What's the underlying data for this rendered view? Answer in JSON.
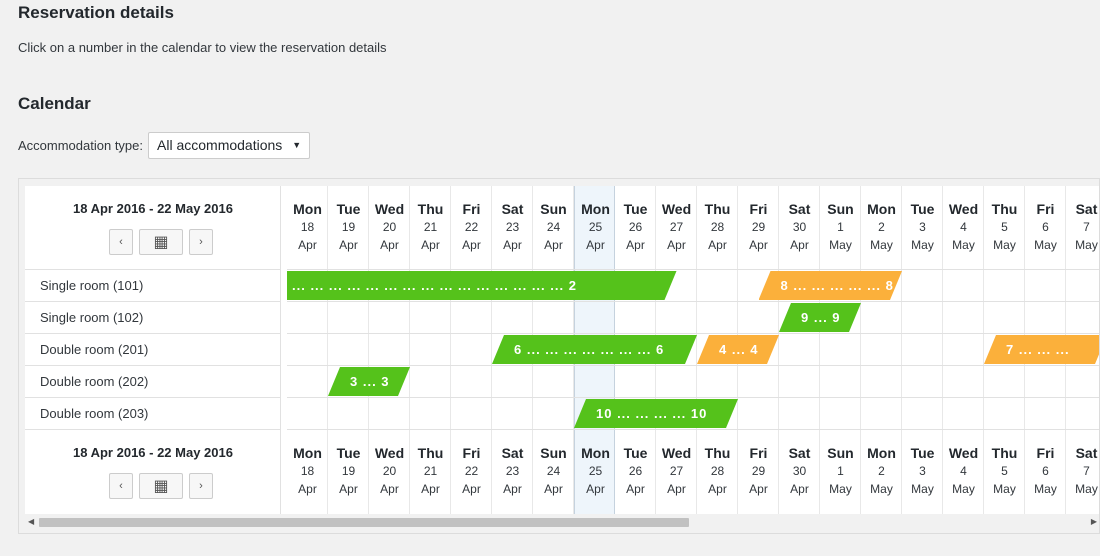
{
  "page": {
    "reservation_title": "Reservation details",
    "reservation_desc": "Click on a number in the calendar to view the reservation details",
    "calendar_title": "Calendar",
    "accommodation_label": "Accommodation type:",
    "accommodation_value": "All accommodations"
  },
  "calendar": {
    "range": "18 Apr 2016 - 22 May 2016",
    "today_index": 7,
    "days": [
      {
        "dn": "Mon",
        "dd": "18",
        "mm": "Apr"
      },
      {
        "dn": "Tue",
        "dd": "19",
        "mm": "Apr"
      },
      {
        "dn": "Wed",
        "dd": "20",
        "mm": "Apr"
      },
      {
        "dn": "Thu",
        "dd": "21",
        "mm": "Apr"
      },
      {
        "dn": "Fri",
        "dd": "22",
        "mm": "Apr"
      },
      {
        "dn": "Sat",
        "dd": "23",
        "mm": "Apr"
      },
      {
        "dn": "Sun",
        "dd": "24",
        "mm": "Apr"
      },
      {
        "dn": "Mon",
        "dd": "25",
        "mm": "Apr"
      },
      {
        "dn": "Tue",
        "dd": "26",
        "mm": "Apr"
      },
      {
        "dn": "Wed",
        "dd": "27",
        "mm": "Apr"
      },
      {
        "dn": "Thu",
        "dd": "28",
        "mm": "Apr"
      },
      {
        "dn": "Fri",
        "dd": "29",
        "mm": "Apr"
      },
      {
        "dn": "Sat",
        "dd": "30",
        "mm": "Apr"
      },
      {
        "dn": "Sun",
        "dd": "1",
        "mm": "May"
      },
      {
        "dn": "Mon",
        "dd": "2",
        "mm": "May"
      },
      {
        "dn": "Tue",
        "dd": "3",
        "mm": "May"
      },
      {
        "dn": "Wed",
        "dd": "4",
        "mm": "May"
      },
      {
        "dn": "Thu",
        "dd": "5",
        "mm": "May"
      },
      {
        "dn": "Fri",
        "dd": "6",
        "mm": "May"
      },
      {
        "dn": "Sat",
        "dd": "7",
        "mm": "May"
      }
    ],
    "rooms": [
      "Single room (101)",
      "Single room (102)",
      "Double room (201)",
      "Double room (202)",
      "Double room (203)"
    ],
    "reservations": [
      {
        "room": 0,
        "start": 0,
        "end": 9.5,
        "color": "green",
        "label": "... ... ... ... ... ... ... ... ... ... ... ... ... ... ... 2"
      },
      {
        "room": 0,
        "start": 11.5,
        "end": 15,
        "color": "orange",
        "label": "8 ... ... ... ... ... 8"
      },
      {
        "room": 1,
        "start": 12,
        "end": 14,
        "color": "green",
        "label": "9 ... 9"
      },
      {
        "room": 2,
        "start": 5,
        "end": 10,
        "color": "green",
        "label": "6 ... ... ... ... ... ... ... 6"
      },
      {
        "room": 2,
        "start": 10,
        "end": 12,
        "color": "orange",
        "label": "4 ... 4"
      },
      {
        "room": 2,
        "start": 17,
        "end": 20,
        "color": "orange",
        "label": "7 ... ... ..."
      },
      {
        "room": 3,
        "start": 1,
        "end": 3,
        "color": "green",
        "label": "3 ... 3"
      },
      {
        "room": 4,
        "start": 7,
        "end": 11,
        "color": "green",
        "label": "10 ... ... ... ... 10"
      }
    ]
  },
  "icons": {
    "prev": "‹",
    "next": "›",
    "calendar": "▦",
    "dropdown": "▼",
    "scroll_left": "◀",
    "scroll_right": "▶"
  }
}
